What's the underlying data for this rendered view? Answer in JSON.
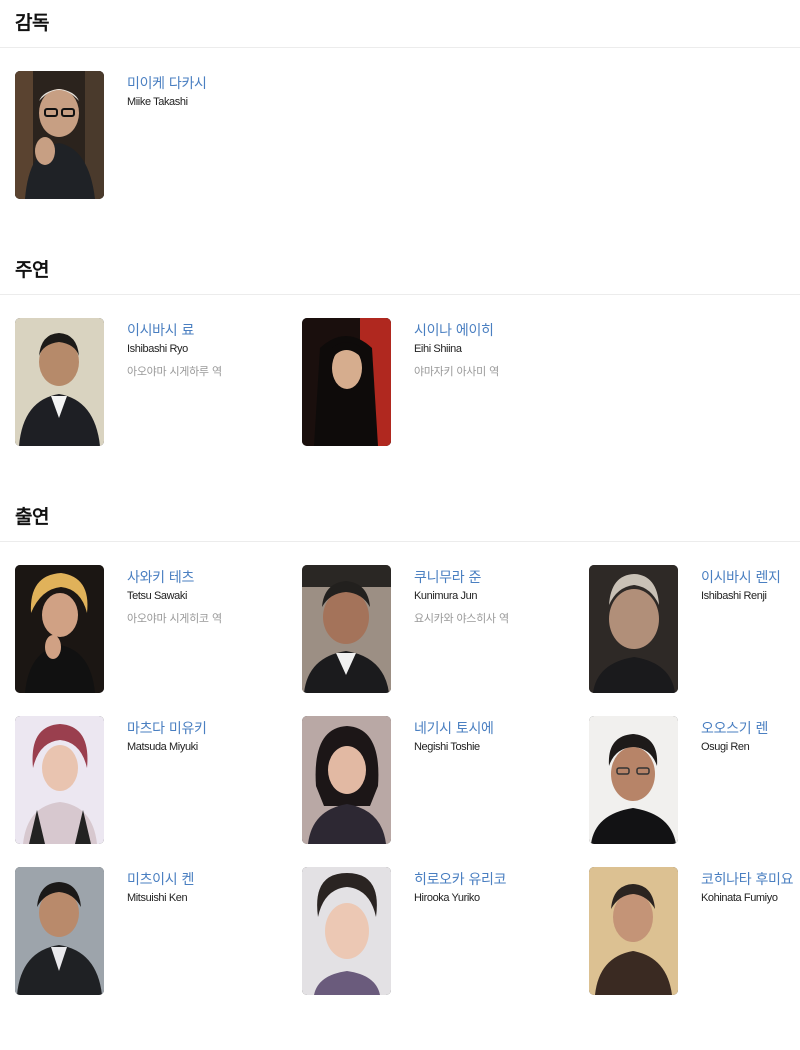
{
  "sections": [
    {
      "title": "감독",
      "people": [
        {
          "name_ko": "미이케 다카시",
          "name_en": "Miike Takashi",
          "role": ""
        }
      ]
    },
    {
      "title": "주연",
      "people": [
        {
          "name_ko": "이시바시 료",
          "name_en": "Ishibashi Ryo",
          "role": "아오야마 시게하루 역"
        },
        {
          "name_ko": "시이나 에이히",
          "name_en": "Eihi Shiina",
          "role": "야마자키 아사미 역"
        }
      ]
    },
    {
      "title": "출연",
      "people": [
        {
          "name_ko": "사와키 테츠",
          "name_en": "Tetsu Sawaki",
          "role": "아오야마 시게히코 역"
        },
        {
          "name_ko": "쿠니무라 준",
          "name_en": "Kunimura Jun",
          "role": "요시카와 야스히사 역"
        },
        {
          "name_ko": "이시바시 렌지",
          "name_en": "Ishibashi Renji",
          "role": ""
        },
        {
          "name_ko": "마츠다 미유키",
          "name_en": "Matsuda Miyuki",
          "role": ""
        },
        {
          "name_ko": "네기시 토시에",
          "name_en": "Negishi Toshie",
          "role": ""
        },
        {
          "name_ko": "오오스기 렌",
          "name_en": "Osugi Ren",
          "role": ""
        },
        {
          "name_ko": "미츠이시 켄",
          "name_en": "Mitsuishi Ken",
          "role": ""
        },
        {
          "name_ko": "히로오카 유리코",
          "name_en": "Hirooka Yuriko",
          "role": ""
        },
        {
          "name_ko": "코히나타 후미요",
          "name_en": "Kohinata Fumiyo",
          "role": ""
        }
      ]
    }
  ],
  "colors": {
    "name_link": "#4a7fc1",
    "role_text": "#999999",
    "divider": "#ececec"
  }
}
